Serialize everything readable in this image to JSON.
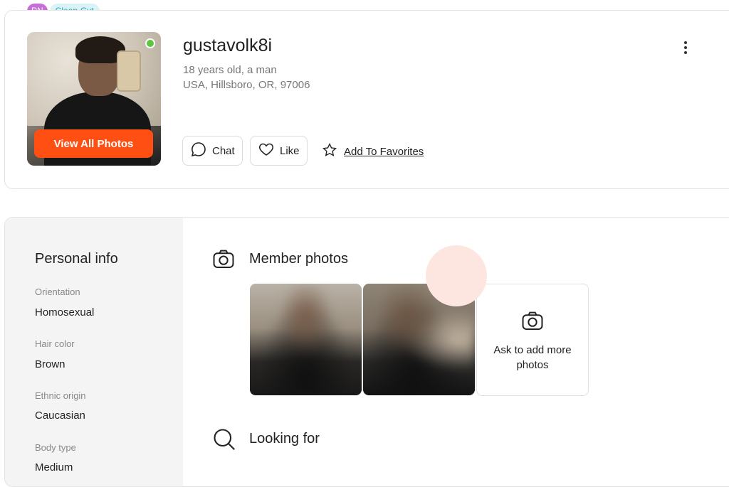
{
  "badges": {
    "pn": "PN",
    "style": "Clean-Cut"
  },
  "profile": {
    "username": "gustavolk8i",
    "age_gender": "18 years old, a man",
    "location": "USA, Hillsboro, OR, 97006",
    "online": true,
    "view_all_photos": "View All Photos",
    "actions": {
      "chat": "Chat",
      "like": "Like",
      "add_to_favorites": "Add To Favorites"
    }
  },
  "personal_info": {
    "title": "Personal info",
    "fields": [
      {
        "label": "Orientation",
        "value": "Homosexual"
      },
      {
        "label": "Hair color",
        "value": "Brown"
      },
      {
        "label": "Ethnic origin",
        "value": "Caucasian"
      },
      {
        "label": "Body type",
        "value": "Medium"
      }
    ]
  },
  "member_photos": {
    "title": "Member photos",
    "ask_more": "Ask to add more photos"
  },
  "looking_for": {
    "title": "Looking for"
  },
  "colors": {
    "accent": "#ff4f13",
    "online": "#5ec63c",
    "badge_pn": "#c86ed8",
    "badge_style_bg": "#d9f3f7",
    "badge_style_text": "#2aa0b4"
  },
  "icons": [
    "chat-bubble-icon",
    "heart-icon",
    "star-icon",
    "camera-icon",
    "search-icon",
    "more-vertical-icon"
  ]
}
